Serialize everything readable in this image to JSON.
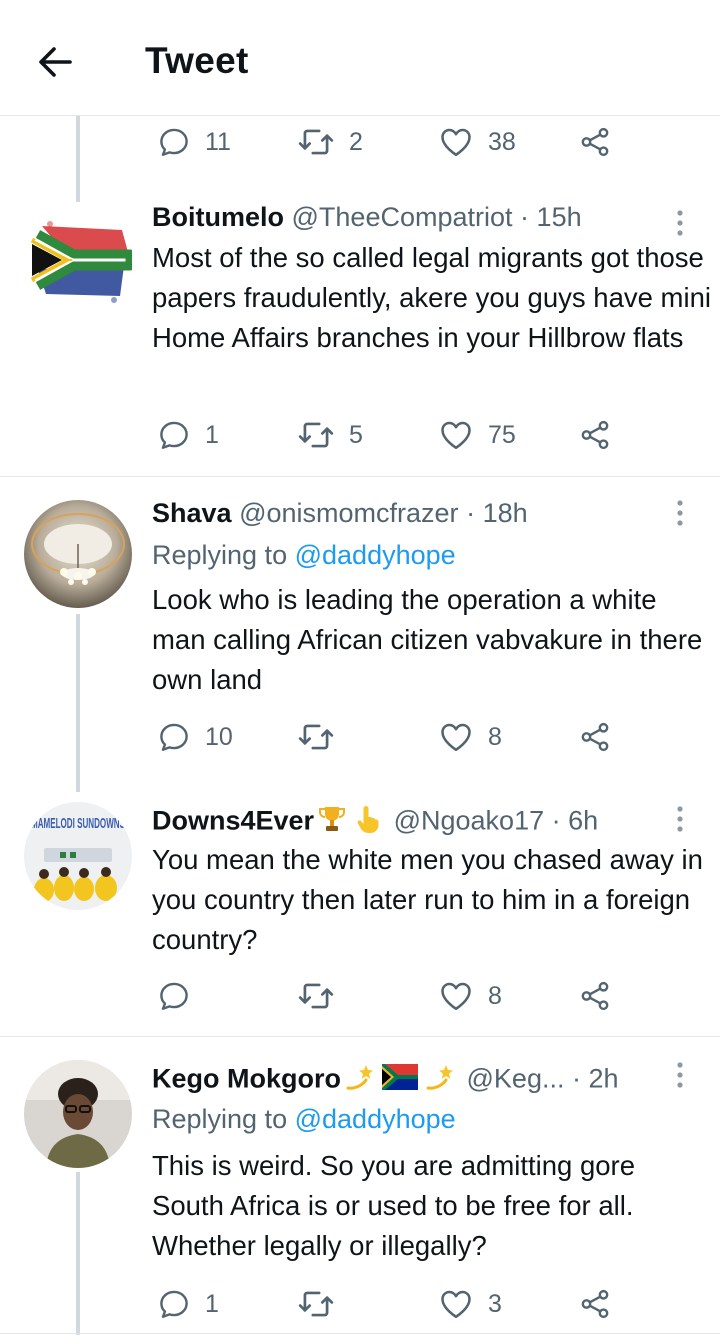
{
  "header": {
    "title": "Tweet"
  },
  "top_actions": {
    "replies": "11",
    "retweets": "2",
    "likes": "38"
  },
  "tweets": [
    {
      "name": "Boitumelo",
      "handle": "@TheeCompatriot",
      "time": "15h",
      "text": "Most of the so called legal migrants got those papers fraudulently, akere you guys have mini Home Affairs branches in your Hillbrow flats",
      "replies": "1",
      "retweets": "5",
      "likes": "75"
    },
    {
      "name": "Shava",
      "handle": "@onismomcfrazer",
      "time": "18h",
      "replying_prefix": "Replying to",
      "replying_user": "@daddyhope",
      "text": "Look who is leading the operation a white man calling African citizen vabvakure in there own land",
      "replies": "10",
      "retweets": "",
      "likes": "8"
    },
    {
      "name": "Downs4Ever",
      "handle": "@Ngoako17",
      "time": "6h",
      "avatar_text": "MAMELODI SUNDOWNS",
      "text": "You mean the white men you chased away in you country then later run to him in a foreign country?",
      "replies": "",
      "retweets": "",
      "likes": "8"
    },
    {
      "name": "Kego Mokgoro",
      "handle": "@Keg...",
      "time": "2h",
      "replying_prefix": "Replying to",
      "replying_user": "@daddyhope",
      "text": "This is weird. So you are admitting gore South Africa is or used to be free for all. Whether legally or illegally?",
      "replies": "1",
      "retweets": "",
      "likes": "3"
    }
  ],
  "colors": {
    "text": "#0f1419",
    "secondary": "#536471",
    "link": "#1d9bf0",
    "divider": "#e1e6ea",
    "thread": "#cfd9de"
  },
  "icons": [
    "back-arrow-icon",
    "reply-icon",
    "retweet-icon",
    "like-icon",
    "share-icon",
    "more-icon",
    "trophy-icon",
    "pointing-hand-icon",
    "dizzy-icon",
    "south-africa-flag-icon"
  ]
}
